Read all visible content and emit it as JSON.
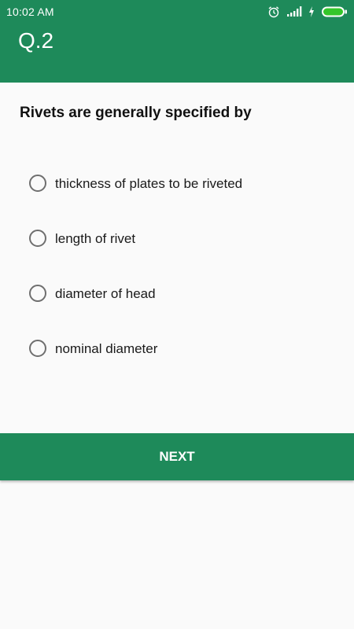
{
  "status_bar": {
    "time": "10:02 AM",
    "icons": [
      "alarm-icon",
      "signal-icon",
      "charging-icon",
      "battery-icon"
    ],
    "battery_color": "#34c62a"
  },
  "app_bar": {
    "title": "Q.2",
    "color": "#1e8a5a"
  },
  "question": {
    "text": "Rivets are generally specified by"
  },
  "options": [
    {
      "label": "thickness of plates to be riveted"
    },
    {
      "label": "length of rivet"
    },
    {
      "label": "diameter of head"
    },
    {
      "label": "nominal diameter"
    }
  ],
  "next_button": {
    "label": "NEXT",
    "color": "#1e8a5a"
  }
}
